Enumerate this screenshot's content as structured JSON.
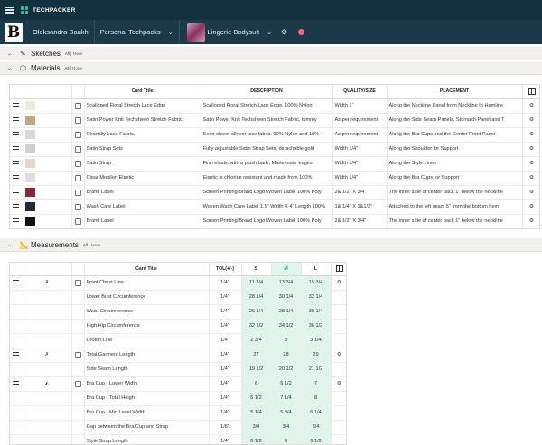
{
  "app": {
    "brand": "TECHPACKER"
  },
  "nav": {
    "logo_letter": "B",
    "user": "Oleksandra Baukh",
    "folder": "Personal Techpacks",
    "product": "Lingerie Bodysuit"
  },
  "sections": {
    "sketches": {
      "title": "Sketches",
      "all": "All",
      "none": "None"
    },
    "materials": {
      "title": "Materials",
      "all": "All",
      "none": "None"
    },
    "measurements": {
      "title": "Measurements",
      "all": "All",
      "none": "None"
    }
  },
  "materials": {
    "headers": [
      "Card Title",
      "DESCRIPTION",
      "QUALITY/SIZE",
      "PLACEMENT"
    ],
    "rows": [
      {
        "swatch": "#f0e9dc",
        "title": "Scalloped Floral Stretch Lace Edge",
        "desc": "Scalloped Floral Stretch Lace Edge, 100% Nylon",
        "qty": "Width 1\"",
        "place": "Along the Neckline Panel from Neckline to Hemline"
      },
      {
        "swatch": "#c3a58a",
        "title": "Satin Power Knit Techsheen Stretch Fabric.",
        "desc": "Satin Power Knit Techsheen Stretch Fabric, tummy",
        "qty": "As per requirement",
        "place": "Along the Side Seam Panels, Stomach Panel and T"
      },
      {
        "swatch": "#d9d9d9",
        "title": "Chantilly Lace Fabric.",
        "desc": "Semi-sheer, allover lace fabric. 90% Nylon and 10%",
        "qty": "As per requirement",
        "place": "Along the Bra Cups and the Center Front Panel"
      },
      {
        "swatch": "#cfcfcf",
        "title": "Satin Strap Sets",
        "desc": "Fully adjustable Satin Strap Sets, detachable gold",
        "qty": "Width 1/4\"",
        "place": "Along the Shoulder for Support"
      },
      {
        "swatch": "#e7d6cf",
        "title": "Satin Strap",
        "desc": "Firm elastic with a plush back, Matte outer edges",
        "qty": "Width 1/4\"",
        "place": "Along the Style Lines"
      },
      {
        "swatch": "#dedede",
        "title": "Clear Mobilon Elastic",
        "desc": "Elastic is chlorine resistant and made from 100%",
        "qty": "Width 1/4\"",
        "place": "Along the Bra Cups for Support"
      },
      {
        "swatch": "#8a2436",
        "title": "Brand Label",
        "desc": "Screen Printing Brand Logo Woven Label 100% Poly",
        "qty": "2& 1/2\" X 3/4\"",
        "place": "The inner side of center back 1\" below the neckline"
      },
      {
        "swatch": "#222a3a",
        "title": "Wash Care Label",
        "desc": "Woven Wash Care Label 1.5\" Width X 4\" Length 100%",
        "qty": "1& 1/4\" X 1&1/2\"",
        "place": "Attached to the left seam 5\" from the bottom hem"
      },
      {
        "swatch": "#111111",
        "title": "Brand Label",
        "desc": "Screen Printing Brand Logo Woven Label 100% Poly",
        "qty": "2& 1/2\" X 3/4\"",
        "place": "The inner side of center back 1\" below the neckline"
      }
    ]
  },
  "measurements": {
    "headers": {
      "title": "Card Title",
      "tol": "TOL(+/-)",
      "s": "S",
      "m": "M",
      "l": "L"
    },
    "groups": [
      {
        "icon": "bodysuit-icon",
        "rows": [
          {
            "title": "Front Chest Line",
            "tol": "1/4\"",
            "s": "11 3/4",
            "m": "13 3/4",
            "l": "15 3/4"
          },
          {
            "title": "Lower Bust Circumference",
            "tol": "1/4\"",
            "s": "28 1/4",
            "m": "30 1/4",
            "l": "32 1/4"
          },
          {
            "title": "Waist Circumference",
            "tol": "1/4\"",
            "s": "26 1/4",
            "m": "28 1/4",
            "l": "30 1/4"
          },
          {
            "title": "High Hip Circumference",
            "tol": "1/4\"",
            "s": "32 1/2",
            "m": "34 1/2",
            "l": "36 1/2"
          },
          {
            "title": "Crotch Line",
            "tol": "1/4\"",
            "s": "2 3/4",
            "m": "3",
            "l": "3 1/4"
          }
        ]
      },
      {
        "icon": "bodysuit-icon",
        "rows": [
          {
            "title": "Total Garment Length",
            "tol": "1/4\"",
            "s": "27",
            "m": "28",
            "l": "29"
          },
          {
            "title": "Side Seam Length",
            "tol": "1/4\"",
            "s": "19 1/2",
            "m": "20 1/2",
            "l": "21 1/2"
          }
        ]
      },
      {
        "icon": "bra-cup-icon",
        "rows": [
          {
            "title": "Bra Cup - Lower Width",
            "tol": "1/4\"",
            "s": "6",
            "m": "6 1/2",
            "l": "7"
          },
          {
            "title": "Bra Cup - Total Height",
            "tol": "1/4\"",
            "s": "6 1/2",
            "m": "7 1/4",
            "l": "8"
          },
          {
            "title": "Bra Cup - Mid Level Width",
            "tol": "1/4\"",
            "s": "5 1/4",
            "m": "5 3/4",
            "l": "6 1/4"
          },
          {
            "title": "Gap between the Bra Cup and Strap",
            "tol": "1/8\"",
            "s": "3/4",
            "m": "3/4",
            "l": "3/4"
          },
          {
            "title": "Style Strap Length",
            "tol": "1/4\"",
            "s": "8 1/2",
            "m": "9",
            "l": "9 1/2"
          }
        ]
      }
    ]
  }
}
